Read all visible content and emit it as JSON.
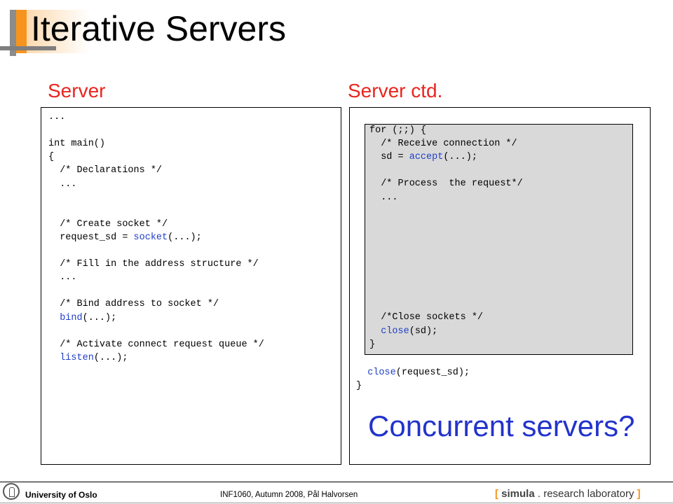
{
  "slide": {
    "title": "Iterative Servers",
    "left_heading": "Server",
    "right_heading": "Server ctd.",
    "question": "Concurrent servers?"
  },
  "left_code": [
    {
      "text": "..."
    },
    {
      "text": ""
    },
    {
      "text": "int main()"
    },
    {
      "text": "{"
    },
    {
      "text": "  /* Declarations */"
    },
    {
      "text": "  ..."
    },
    {
      "text": ""
    },
    {
      "text": ""
    },
    {
      "text": "  /* Create socket */"
    },
    {
      "pre": "  request_sd = ",
      "fn": "socket",
      "post": "(...);"
    },
    {
      "text": ""
    },
    {
      "text": "  /* Fill in the address structure */"
    },
    {
      "text": "  ..."
    },
    {
      "text": ""
    },
    {
      "text": "  /* Bind address to socket */"
    },
    {
      "pre": "  ",
      "fn": "bind",
      "post": "(...);"
    },
    {
      "text": ""
    },
    {
      "text": "  /* Activate connect request queue */"
    },
    {
      "pre": "  ",
      "fn": "listen",
      "post": "(...);"
    }
  ],
  "loop_code": [
    {
      "text": "for (;;) {"
    },
    {
      "text": "  /* Receive connection */"
    },
    {
      "pre": "  sd = ",
      "fn": "accept",
      "post": "(...);"
    },
    {
      "text": ""
    },
    {
      "text": "  /* Process  the request*/"
    },
    {
      "text": "  ..."
    },
    {
      "text": ""
    },
    {
      "text": ""
    },
    {
      "text": ""
    },
    {
      "text": ""
    },
    {
      "text": ""
    },
    {
      "text": ""
    },
    {
      "text": ""
    },
    {
      "text": ""
    },
    {
      "text": "  /*Close sockets */"
    },
    {
      "pre": "  ",
      "fn": "close",
      "post": "(sd);"
    },
    {
      "text": "}"
    }
  ],
  "tail_code": [
    {
      "pre": "  ",
      "fn": "close",
      "post": "(request_sd);"
    },
    {
      "text": "}"
    }
  ],
  "footer": {
    "institution": "University of Oslo",
    "course": "INF1060,  Autumn 2008, Pål Halvorsen",
    "lab_open": "[",
    "lab_name": "simula",
    "lab_rest": ". research laboratory",
    "lab_close": "]"
  },
  "colors": {
    "heading": "#e8261e",
    "function": "#1f3ec8",
    "question": "#2233cc",
    "accent": "#f7941d",
    "loop_bg": "#d9d9d9"
  }
}
